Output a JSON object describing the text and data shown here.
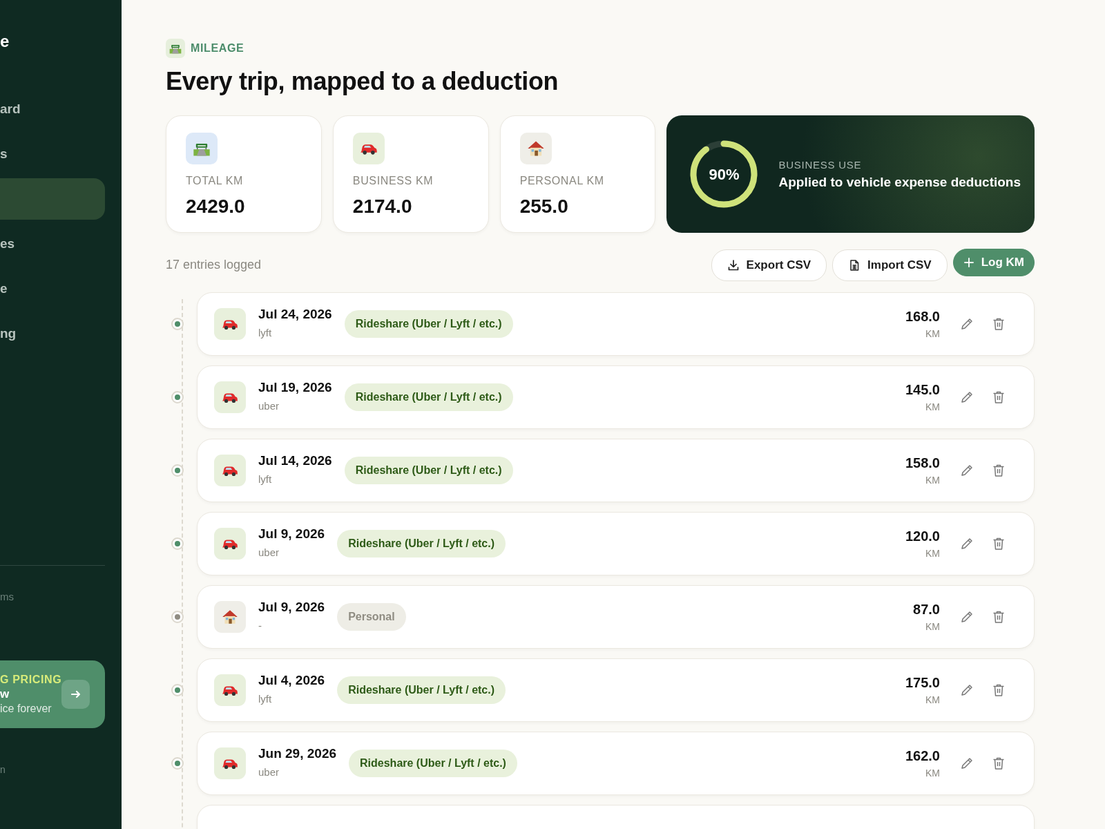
{
  "sidebar": {
    "logo": "e",
    "items": [
      {
        "label": "ard",
        "selected": false
      },
      {
        "label": "s",
        "selected": false
      },
      {
        "selected": true
      },
      {
        "label": "es",
        "selected": false
      },
      {
        "label": "e",
        "selected": false
      },
      {
        "label": "ng",
        "selected": false
      }
    ],
    "section_label": "ms",
    "promo": {
      "eyebrow": "G PRICING",
      "title": "w",
      "subtitle": "ice forever"
    },
    "footer": "n"
  },
  "header": {
    "eyebrow": "MILEAGE",
    "title": "Every trip, mapped to a deduction"
  },
  "stats": [
    {
      "kind": "road",
      "label": "TOTAL KM",
      "value": "2429.0"
    },
    {
      "kind": "car",
      "label": "BUSINESS KM",
      "value": "2174.0"
    },
    {
      "kind": "house",
      "label": "PERSONAL KM",
      "value": "255.0"
    }
  ],
  "business_use": {
    "label": "BUSINESS USE",
    "percent": "90%",
    "level": 0.9,
    "text": "Applied to vehicle expense deductions"
  },
  "toolbar": {
    "count": "17 entries logged",
    "buttons": [
      {
        "kind": "export",
        "label": "Export CSV"
      },
      {
        "kind": "import",
        "label": "Import CSV"
      },
      {
        "kind": "add",
        "label": "Log KM"
      }
    ]
  },
  "entries": [
    {
      "kind": "business",
      "date": "Jul 24, 2026",
      "platform": "lyft",
      "category": "Rideshare (Uber / Lyft / etc.)",
      "distance": "168.0",
      "unit": "KM"
    },
    {
      "kind": "business",
      "date": "Jul 19, 2026",
      "platform": "uber",
      "category": "Rideshare (Uber / Lyft / etc.)",
      "distance": "145.0",
      "unit": "KM"
    },
    {
      "kind": "business",
      "date": "Jul 14, 2026",
      "platform": "lyft",
      "category": "Rideshare (Uber / Lyft / etc.)",
      "distance": "158.0",
      "unit": "KM"
    },
    {
      "kind": "business",
      "date": "Jul 9, 2026",
      "platform": "uber",
      "category": "Rideshare (Uber / Lyft / etc.)",
      "distance": "120.0",
      "unit": "KM"
    },
    {
      "kind": "personal",
      "date": "Jul 9, 2026",
      "platform": "-",
      "category": "Personal",
      "distance": "87.0",
      "unit": "KM"
    },
    {
      "kind": "business",
      "date": "Jul 4, 2026",
      "platform": "lyft",
      "category": "Rideshare (Uber / Lyft / etc.)",
      "distance": "175.0",
      "unit": "KM"
    },
    {
      "kind": "business",
      "date": "Jun 29, 2026",
      "platform": "uber",
      "category": "Rideshare (Uber / Lyft / etc.)",
      "distance": "162.0",
      "unit": "KM"
    }
  ]
}
